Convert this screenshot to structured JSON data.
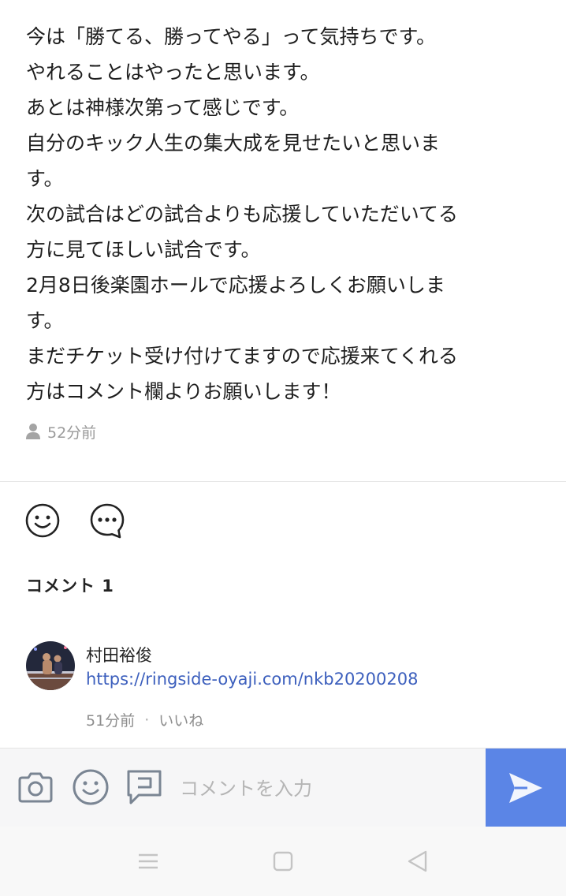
{
  "post": {
    "lines": [
      "今は「勝てる、勝ってやる」って気持ちです。",
      "やれることはやったと思います。",
      "あとは神様次第って感じです。",
      "自分のキック人生の集大成を見せたいと思いま",
      "す。",
      "次の試合はどの試合よりも応援していただいてる",
      "方に見てほしい試合です。",
      "2月8日後楽園ホールで応援よろしくお願いしま",
      "す。",
      "まだチケット受け付けてますので応援来てくれる",
      "方はコメント欄よりお願いします！"
    ],
    "time": "52分前",
    "meta_icon": "person-icon"
  },
  "reactions": {
    "like_icon": "smiley-icon",
    "comment_icon": "speech-bubble-icon"
  },
  "comments_section": {
    "count_label": "コメント 1"
  },
  "comments": [
    {
      "author": "村田裕俊",
      "text": "https://ringside-oyaji.com/nkb20200208",
      "time": "51分前",
      "separator": "·",
      "like_label": "いいね"
    }
  ],
  "composer": {
    "placeholder": "コメントを入力",
    "icons": [
      "camera-icon",
      "sticker-icon",
      "chat-icon",
      "send-icon"
    ]
  },
  "nav": {
    "icons": [
      "menu-icon",
      "home-icon",
      "back-icon"
    ]
  },
  "colors": {
    "accent": "#5b85e6",
    "link": "#3c5fbd",
    "muted": "#9a9a9a",
    "icon": "#7a8593"
  }
}
